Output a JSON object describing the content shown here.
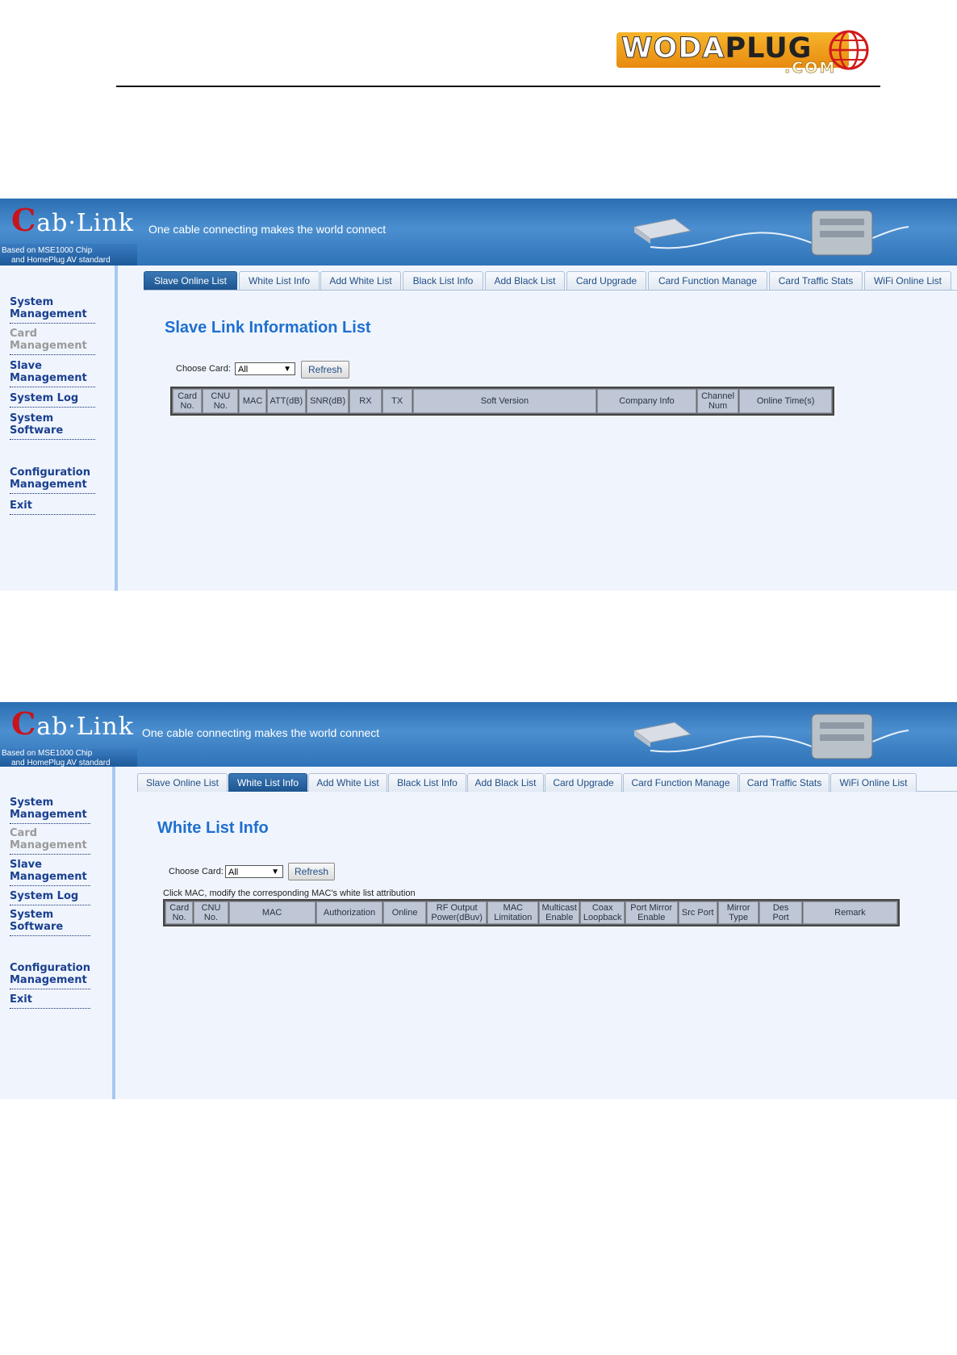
{
  "doc_logo": {
    "word_left": "WODA",
    "word_right": "PLUG",
    "dotcom": ".COM"
  },
  "screens": [
    {
      "brand": "ab·Link",
      "brand_initial": "C",
      "standard_line1": "Based on MSE1000 Chip",
      "standard_line2": "and HomePlug AV standard",
      "slogan": "One cable connecting makes the world connect",
      "menu": [
        {
          "line1": "System",
          "line2": "Management"
        },
        {
          "line1": "Card",
          "line2": "Management"
        },
        {
          "line1": "Slave",
          "line2": "Management"
        },
        {
          "line1": "System Log",
          "line2": ""
        },
        {
          "line1": "System",
          "line2": "Software"
        },
        {
          "line1": "Configuration",
          "line2": "Management"
        },
        {
          "line1": "Exit",
          "line2": ""
        }
      ],
      "tabs": [
        "Slave Online List",
        "White List Info",
        "Add White List",
        "Black List Info",
        "Add Black List",
        "Card Upgrade",
        "Card Function Manage",
        "Card Traffic Stats",
        "WiFi Online List"
      ],
      "active_tab": "Slave Online List",
      "page_title": "Slave Link Information List",
      "choose_label": "Choose Card:",
      "select_value": "All",
      "refresh_label": "Refresh",
      "columns": [
        {
          "l1": "Card",
          "l2": "No."
        },
        {
          "l1": "CNU",
          "l2": "No."
        },
        {
          "l1": "MAC",
          "l2": ""
        },
        {
          "l1": "ATT(dB)",
          "l2": ""
        },
        {
          "l1": "SNR(dB)",
          "l2": ""
        },
        {
          "l1": "RX",
          "l2": ""
        },
        {
          "l1": "TX",
          "l2": ""
        },
        {
          "l1": "Soft Version",
          "l2": ""
        },
        {
          "l1": "Company Info",
          "l2": ""
        },
        {
          "l1": "Channel",
          "l2": "Num"
        },
        {
          "l1": "Online Time(s)",
          "l2": ""
        }
      ]
    },
    {
      "brand": "ab·Link",
      "brand_initial": "C",
      "standard_line1": "Based on MSE1000 Chip",
      "standard_line2": "and HomePlug AV standard",
      "slogan": "One cable connecting makes the world connect",
      "menu": [
        {
          "line1": "System",
          "line2": "Management"
        },
        {
          "line1": "Card",
          "line2": "Management"
        },
        {
          "line1": "Slave",
          "line2": "Management"
        },
        {
          "line1": "System Log",
          "line2": ""
        },
        {
          "line1": "System",
          "line2": "Software"
        },
        {
          "line1": "Configuration",
          "line2": "Management"
        },
        {
          "line1": "Exit",
          "line2": ""
        }
      ],
      "tabs": [
        "Slave Online List",
        "White List Info",
        "Add White List",
        "Black List Info",
        "Add Black List",
        "Card Upgrade",
        "Card Function Manage",
        "Card Traffic Stats",
        "WiFi Online List"
      ],
      "active_tab": "White List Info",
      "page_title": "White List Info",
      "choose_label": "Choose Card:",
      "select_value": "All",
      "refresh_label": "Refresh",
      "hint": "Click MAC, modify the corresponding MAC's white list attribution",
      "columns": [
        {
          "l1": "Card",
          "l2": "No."
        },
        {
          "l1": "CNU",
          "l2": "No."
        },
        {
          "l1": "MAC",
          "l2": ""
        },
        {
          "l1": "Authorization",
          "l2": ""
        },
        {
          "l1": "Online",
          "l2": ""
        },
        {
          "l1": "RF Output",
          "l2": "Power(dBuv)"
        },
        {
          "l1": "MAC",
          "l2": "Limitation"
        },
        {
          "l1": "Multicast",
          "l2": "Enable"
        },
        {
          "l1": "Coax",
          "l2": "Loopback"
        },
        {
          "l1": "Port Mirror",
          "l2": "Enable"
        },
        {
          "l1": "Src Port",
          "l2": ""
        },
        {
          "l1": "Mirror",
          "l2": "Type"
        },
        {
          "l1": "Des",
          "l2": "Port"
        },
        {
          "l1": "Remark",
          "l2": ""
        }
      ]
    }
  ]
}
